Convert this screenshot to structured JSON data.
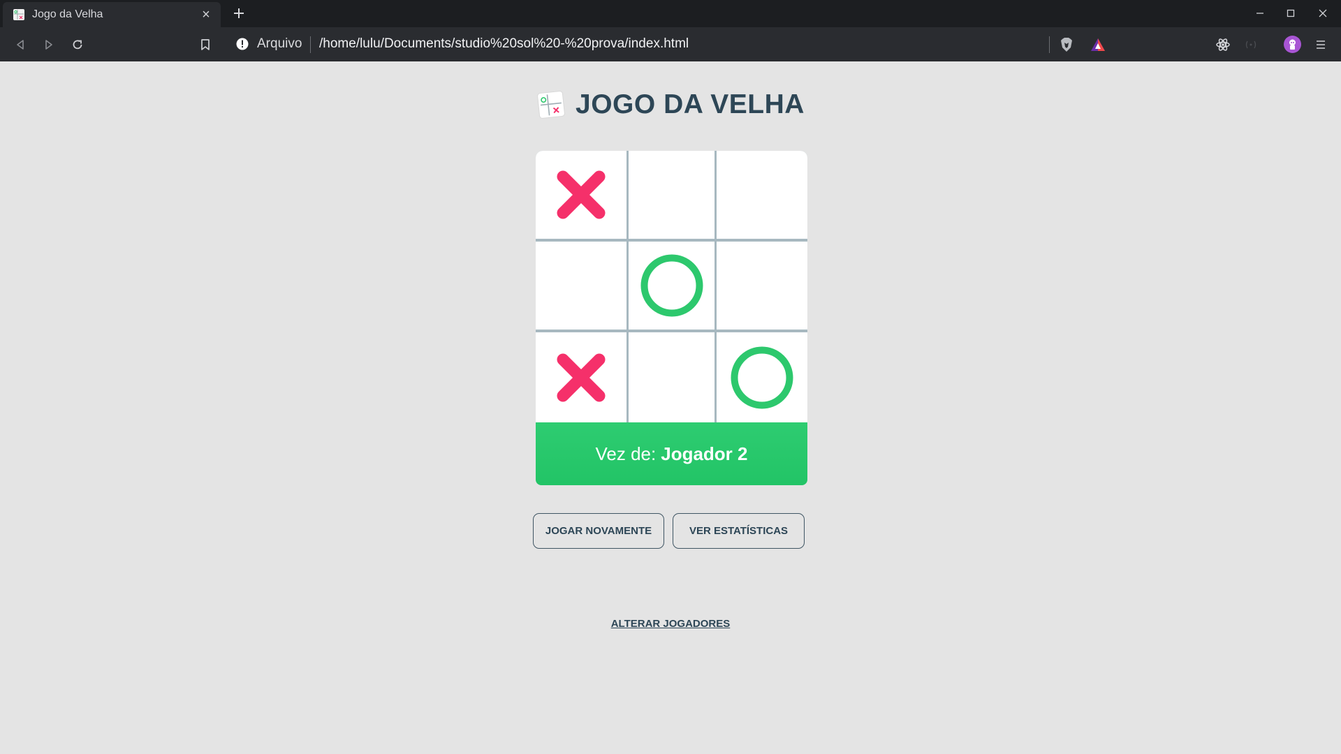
{
  "browser": {
    "tab": {
      "title": "Jogo da Velha",
      "close_glyph": "×"
    },
    "address": {
      "scheme": "Arquivo",
      "url": "/home/lulu/Documents/studio%20sol%20-%20prova/index.html"
    },
    "icons": [
      "back-icon",
      "forward-icon",
      "reload-icon",
      "bookmark-icon",
      "info-icon",
      "brave-shield-icon",
      "brave-rewards-icon",
      "react-devtools-icon",
      "extension-icon",
      "profile-avatar",
      "menu-icon"
    ]
  },
  "page": {
    "title": "JOGO DA VELHA",
    "board": {
      "cells": [
        "X",
        "",
        "",
        "",
        "O",
        "",
        "X",
        "",
        "O"
      ]
    },
    "status": {
      "prefix": "Vez de:",
      "player": "Jogador 2"
    },
    "buttons": {
      "play_again": "JOGAR NOVAMENTE",
      "stats": "VER ESTATÍSTICAS"
    },
    "change_players_link": "ALTERAR JOGADORES"
  },
  "colors": {
    "x": "#f5306a",
    "o": "#2dc86d",
    "status_bg": "#2ecc71",
    "title": "#2d4656",
    "grid": "#a7b8c0",
    "page_bg": "#e4e4e4"
  }
}
